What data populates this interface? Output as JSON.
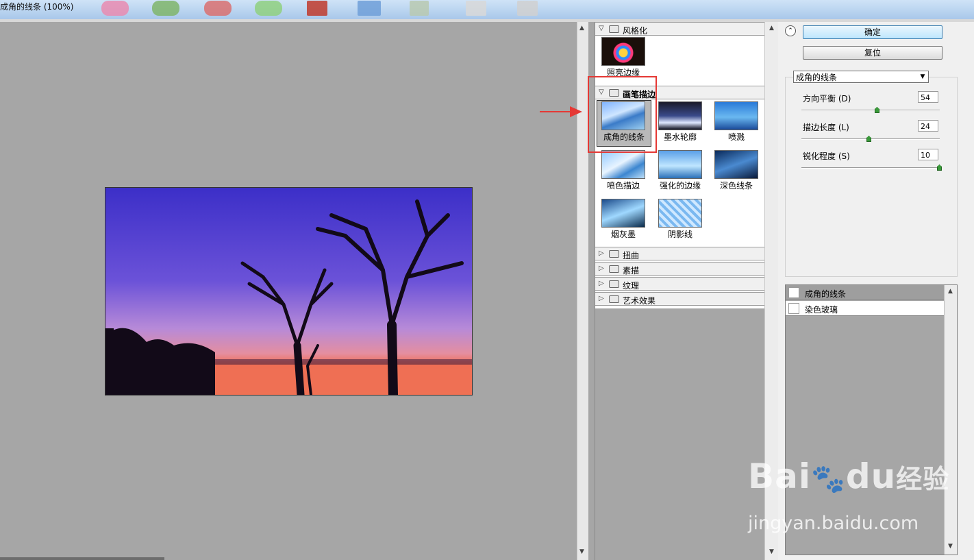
{
  "window": {
    "title": "成角的线条 (100%)"
  },
  "gallery": {
    "categories": [
      {
        "label": "风格化",
        "expanded": true,
        "thumbs": [
          {
            "label": "照亮边缘"
          }
        ]
      },
      {
        "label": "画笔描边",
        "expanded": true,
        "thumbs": [
          {
            "label": "成角的线条",
            "selected": true
          },
          {
            "label": "墨水轮廓"
          },
          {
            "label": "喷溅"
          },
          {
            "label": "喷色描边"
          },
          {
            "label": "强化的边缘"
          },
          {
            "label": "深色线条"
          },
          {
            "label": "烟灰墨"
          },
          {
            "label": "阴影线"
          }
        ]
      },
      {
        "label": "扭曲",
        "expanded": false
      },
      {
        "label": "素描",
        "expanded": false
      },
      {
        "label": "纹理",
        "expanded": false
      },
      {
        "label": "艺术效果",
        "expanded": false
      }
    ]
  },
  "panel": {
    "ok_label": "确定",
    "reset_label": "复位",
    "filter_select": "成角的线条",
    "params": [
      {
        "label": "方向平衡 (D)",
        "value": "54",
        "max": 100
      },
      {
        "label": "描边长度 (L)",
        "value": "24",
        "max": 50
      },
      {
        "label": "锐化程度 (S)",
        "value": "10",
        "max": 10
      }
    ]
  },
  "layers": [
    {
      "name": "成角的线条",
      "active": true
    },
    {
      "name": "染色玻璃",
      "active": false
    }
  ],
  "watermark": {
    "brand": "Bai",
    "brand2": "du",
    "brand3": "经验",
    "url": "jingyan.baidu.com"
  },
  "colors": {
    "highlight": "#e53935",
    "arrow": "#e53935",
    "preview_bg": "#a6a6a6"
  }
}
